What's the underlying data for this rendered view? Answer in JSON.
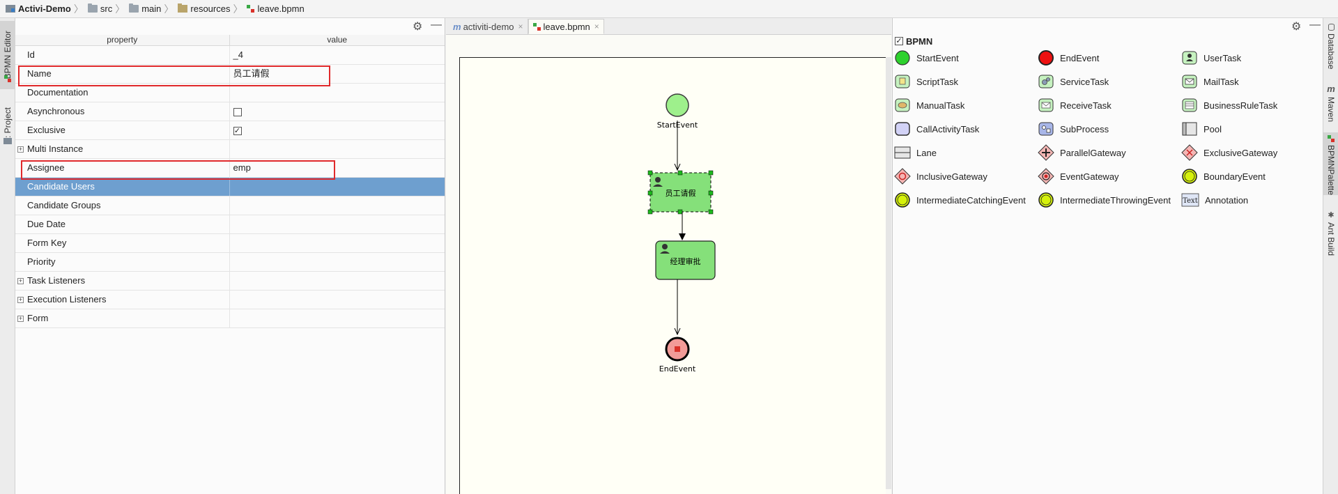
{
  "breadcrumb": [
    {
      "label": "Activi-Demo",
      "icon": "project-icon"
    },
    {
      "label": "src",
      "icon": "folder-icon"
    },
    {
      "label": "main",
      "icon": "folder-icon"
    },
    {
      "label": "resources",
      "icon": "resources-folder-icon"
    },
    {
      "label": "leave.bpmn",
      "icon": "bpmn-file-icon"
    }
  ],
  "left_strip": {
    "bpmn_editor": "BPMN Editor",
    "project": "1: Project"
  },
  "right_strip": {
    "database": "Database",
    "maven": "Maven",
    "bpmn_palette": "BPMNPalette",
    "ant_build": "Ant Build"
  },
  "properties": {
    "header_property": "property",
    "header_value": "value",
    "rows": [
      {
        "key": "Id",
        "value": "_4"
      },
      {
        "key": "Name",
        "value": "员工请假"
      },
      {
        "key": "Documentation",
        "value": ""
      },
      {
        "key": "Asynchronous",
        "value": ""
      },
      {
        "key": "Exclusive",
        "value": "✓"
      },
      {
        "key": "Multi Instance",
        "value": ""
      },
      {
        "key": "Assignee",
        "value": "emp"
      },
      {
        "key": "Candidate Users",
        "value": ""
      },
      {
        "key": "Candidate Groups",
        "value": ""
      },
      {
        "key": "Due Date",
        "value": ""
      },
      {
        "key": "Form Key",
        "value": ""
      },
      {
        "key": "Priority",
        "value": ""
      },
      {
        "key": "Task Listeners",
        "value": ""
      },
      {
        "key": "Execution Listeners",
        "value": ""
      },
      {
        "key": "Form",
        "value": ""
      }
    ]
  },
  "editor": {
    "tabs": [
      {
        "label": "activiti-demo"
      },
      {
        "label": "leave.bpmn"
      }
    ],
    "diagram": {
      "start_label": "StartEvent",
      "task1_label": "员工请假",
      "task2_label": "经理审批",
      "end_label": "EndEvent"
    }
  },
  "palette": {
    "title": "BPMN",
    "items": [
      "StartEvent",
      "EndEvent",
      "UserTask",
      "ScriptTask",
      "ServiceTask",
      "MailTask",
      "ManualTask",
      "ReceiveTask",
      "BusinessRuleTask",
      "CallActivityTask",
      "SubProcess",
      "Pool",
      "Lane",
      "ParallelGateway",
      "ExclusiveGateway",
      "InclusiveGateway",
      "EventGateway",
      "BoundaryEvent",
      "IntermediateCatchingEvent",
      "IntermediateThrowingEvent",
      "Annotation"
    ],
    "annotation_icon_text": "Text"
  }
}
